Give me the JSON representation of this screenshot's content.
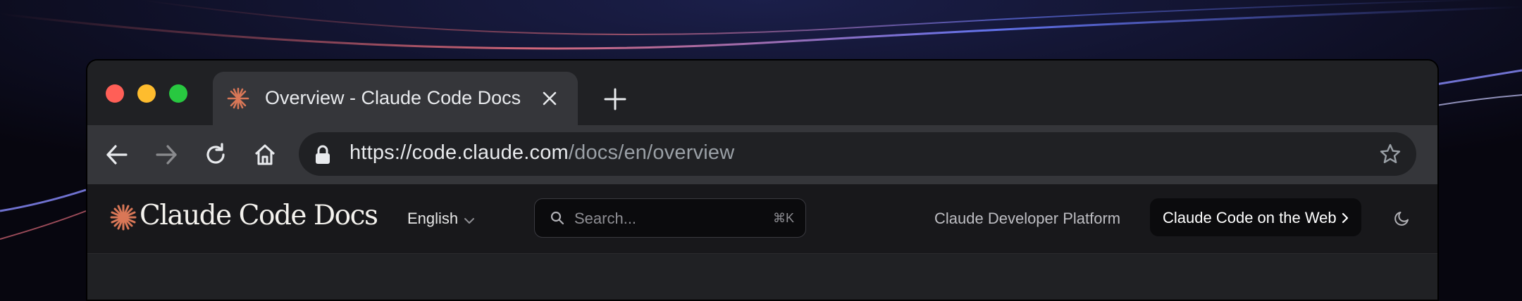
{
  "browser": {
    "tab": {
      "title": "Overview - Claude Code Docs",
      "icon": "claude-starburst-icon",
      "close_icon": "close-icon"
    },
    "new_tab_icon": "plus-icon",
    "window_controls": {
      "close": "#ff5f57",
      "minimize": "#febc2e",
      "maximize": "#28c840"
    },
    "toolbar": {
      "back_icon": "arrow-left-icon",
      "forward_icon": "arrow-right-icon",
      "reload_icon": "reload-icon",
      "home_icon": "home-icon"
    },
    "address_bar": {
      "url_host": "https://code.claude.com",
      "url_path": "/docs/en/overview",
      "lock_icon": "lock-icon",
      "bookmark_icon": "star-icon"
    }
  },
  "site_header": {
    "logo_text": "Claude Code Docs",
    "logo_icon": "claude-starburst-icon",
    "language": "English",
    "search": {
      "placeholder": "Search...",
      "shortcut": "⌘K"
    },
    "nav_link": "Claude Developer Platform",
    "cta_label": "Claude Code on the Web",
    "theme_icon": "moon-icon"
  },
  "colors": {
    "accent": "#d97757",
    "tab_active": "#35363a",
    "tabstrip": "#202124",
    "header_bg": "#18181b"
  }
}
